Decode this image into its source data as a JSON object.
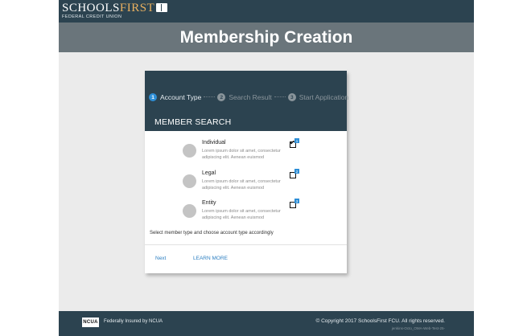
{
  "header": {
    "logo_main": "SCHOOLS",
    "logo_first": "FIRST",
    "logo_sub": "FEDERAL CREDIT UNION",
    "page_title": "Membership Creation"
  },
  "steps": [
    {
      "num": "1",
      "label": "Account Type",
      "active": true
    },
    {
      "num": "2",
      "label": "Search Result",
      "active": false
    },
    {
      "num": "3",
      "label": "Start Application",
      "active": false
    }
  ],
  "card": {
    "title": "MEMBER SEARCH",
    "options": [
      {
        "name": "Individual",
        "desc": "Lorem ipsum dolor sit amet, consectetur adipiscing elit. Aenean euismod",
        "checked": true,
        "badge": "1"
      },
      {
        "name": "Legal",
        "desc": "Lorem ipsum dolor sit amet, consectetur adipiscing elit. Aenean euismod",
        "checked": false,
        "badge": "2"
      },
      {
        "name": "Entity",
        "desc": "Lorem ipsum dolor sit amet, consectetur adipiscing elit. Aenean euismod",
        "checked": false,
        "badge": "3"
      }
    ],
    "hint": "Select member type and choose account type accordingly",
    "next_label": "Next",
    "learn_more_label": "LEARN MORE"
  },
  "footer": {
    "ncua_logo": "NCUA",
    "insured_text": "Federally Insured by NCUA",
    "copyright": "© Copyright 2017 SchoolsFirst FCU. All rights reserved.",
    "build": "jenkins-Octo_OMA-Web-Test-25-"
  },
  "colors": {
    "header_bg": "#2c4350",
    "title_bg": "#6a757b",
    "accent": "#2d8ed6",
    "link": "#2d7fc2"
  }
}
